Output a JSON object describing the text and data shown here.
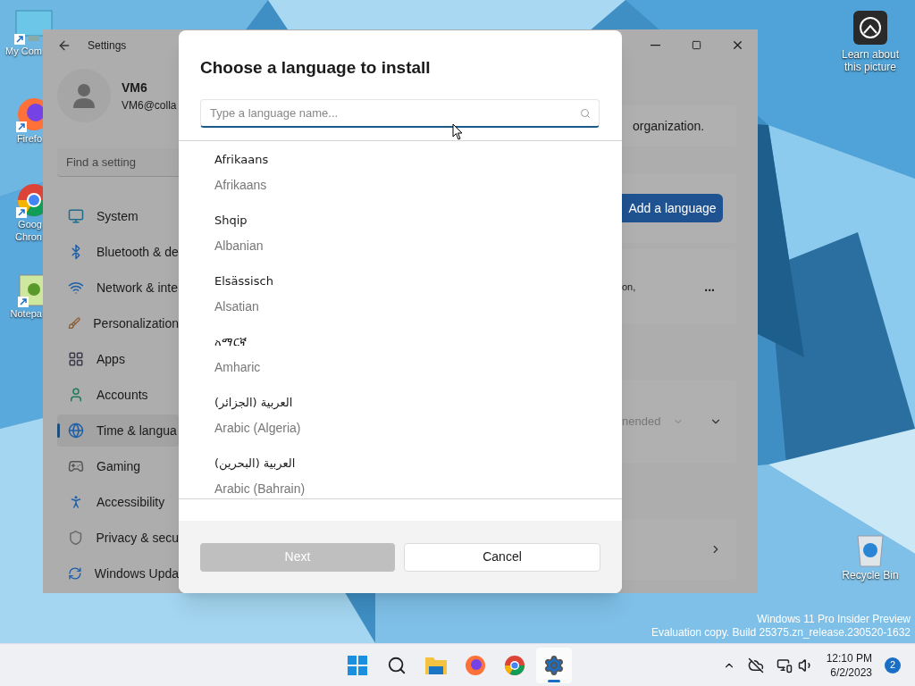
{
  "desktop": {
    "icons": [
      {
        "kind": "computer",
        "lines": [
          "My Com"
        ]
      },
      {
        "kind": "firefox",
        "lines": [
          "Firefo"
        ]
      },
      {
        "kind": "chrome",
        "lines": [
          "Goog",
          "Chron"
        ]
      },
      {
        "kind": "notepad",
        "lines": [
          "Notepa"
        ]
      }
    ],
    "spotlight": {
      "label": "Learn about this picture"
    },
    "recycle_bin": {
      "label": "Recycle Bin"
    },
    "watermark": [
      "Windows 11 Pro Insider Preview",
      "Evaluation copy. Build 25375.zn_release.230520-1632"
    ]
  },
  "settings_window": {
    "title": "Settings",
    "user": {
      "name": "VM6",
      "email": "VM6@colla"
    },
    "search": {
      "placeholder": "Find a setting"
    },
    "nav": [
      {
        "kind": "system",
        "label": "System",
        "selected": false
      },
      {
        "kind": "bluetooth",
        "label": "Bluetooth & de",
        "selected": false
      },
      {
        "kind": "network",
        "label": "Network & inte",
        "selected": false
      },
      {
        "kind": "personalization",
        "label": "Personalization",
        "selected": false
      },
      {
        "kind": "apps",
        "label": "Apps",
        "selected": false
      },
      {
        "kind": "accounts",
        "label": "Accounts",
        "selected": false
      },
      {
        "kind": "time",
        "label": "Time & langua",
        "selected": true
      },
      {
        "kind": "gaming",
        "label": "Gaming",
        "selected": false
      },
      {
        "kind": "accessibility",
        "label": "Accessibility",
        "selected": false
      },
      {
        "kind": "privacy",
        "label": "Privacy & secu",
        "selected": false
      },
      {
        "kind": "update",
        "label": "Windows Upda",
        "selected": false
      }
    ],
    "content": {
      "note": "organization.",
      "add_button": "Add a language",
      "card_text": "on,",
      "more": "...",
      "dropdown": "nended"
    }
  },
  "dialog": {
    "title": "Choose a language to install",
    "search": {
      "placeholder": "Type a language name..."
    },
    "languages": [
      {
        "native": "Afrikaans",
        "english": "Afrikaans"
      },
      {
        "native": "Shqip",
        "english": "Albanian"
      },
      {
        "native": "Elsässisch",
        "english": "Alsatian"
      },
      {
        "native": "አማርኛ",
        "english": "Amharic"
      },
      {
        "native": "العربية (الجزائر)",
        "english": "Arabic (Algeria)"
      },
      {
        "native": "العربية (البحرين)",
        "english": "Arabic (Bahrain)"
      }
    ],
    "buttons": [
      {
        "label": "Next",
        "disabled": true
      },
      {
        "label": "Cancel",
        "disabled": false
      }
    ]
  },
  "taskbar": {
    "apps": [
      {
        "kind": "start",
        "selected": false
      },
      {
        "kind": "search",
        "selected": false
      },
      {
        "kind": "explorer",
        "selected": false
      },
      {
        "kind": "firefox",
        "selected": false
      },
      {
        "kind": "chrome",
        "selected": false
      },
      {
        "kind": "settings",
        "selected": true
      }
    ],
    "time": "12:10 PM",
    "date": "6/2/2023",
    "notifications": "2"
  }
}
